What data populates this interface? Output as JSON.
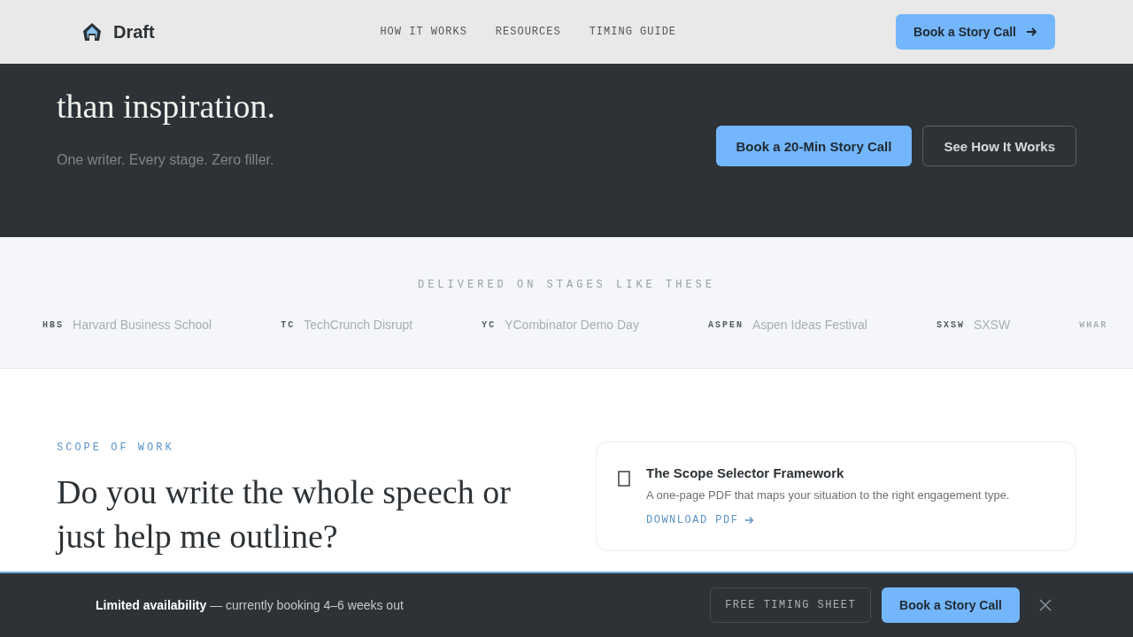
{
  "nav": {
    "brand": "Draft",
    "links": [
      "HOW IT WORKS",
      "RESOURCES",
      "TIMING GUIDE"
    ],
    "cta": "Book a Story Call"
  },
  "hero": {
    "headline": "than inspiration.",
    "subtitle": "One writer. Every stage. Zero filler.",
    "buttons": [
      {
        "label": "Book a 20-Min Story Call",
        "kind": "primary"
      },
      {
        "label": "See How It Works",
        "kind": "outline"
      }
    ]
  },
  "stages": {
    "title": "DELIVERED ON STAGES LIKE THESE",
    "logos": [
      {
        "abbr": "HBS",
        "name": "Harvard Business School"
      },
      {
        "abbr": "TC",
        "name": "TechCrunch Disrupt"
      },
      {
        "abbr": "YC",
        "name": "YCombinator Demo Day"
      },
      {
        "abbr": "ASPEN",
        "name": "Aspen Ideas Festival"
      },
      {
        "abbr": "SXSW",
        "name": "SXSW"
      },
      {
        "abbr": "WHAR"
      }
    ]
  },
  "scope": {
    "eyebrow": "SCOPE OF WORK",
    "heading": "Do you write the whole speech or just help me outline?",
    "resource": {
      "title": "The Scope Selector Framework",
      "description": "A one-page PDF that maps your situation to the right engagement type.",
      "link": "DOWNLOAD PDF"
    }
  },
  "banner": {
    "text": "**Limited availability** — currently booking 4–6 weeks out",
    "secondary": "FREE TIMING SHEET",
    "primary": "Book a Story Call"
  }
}
